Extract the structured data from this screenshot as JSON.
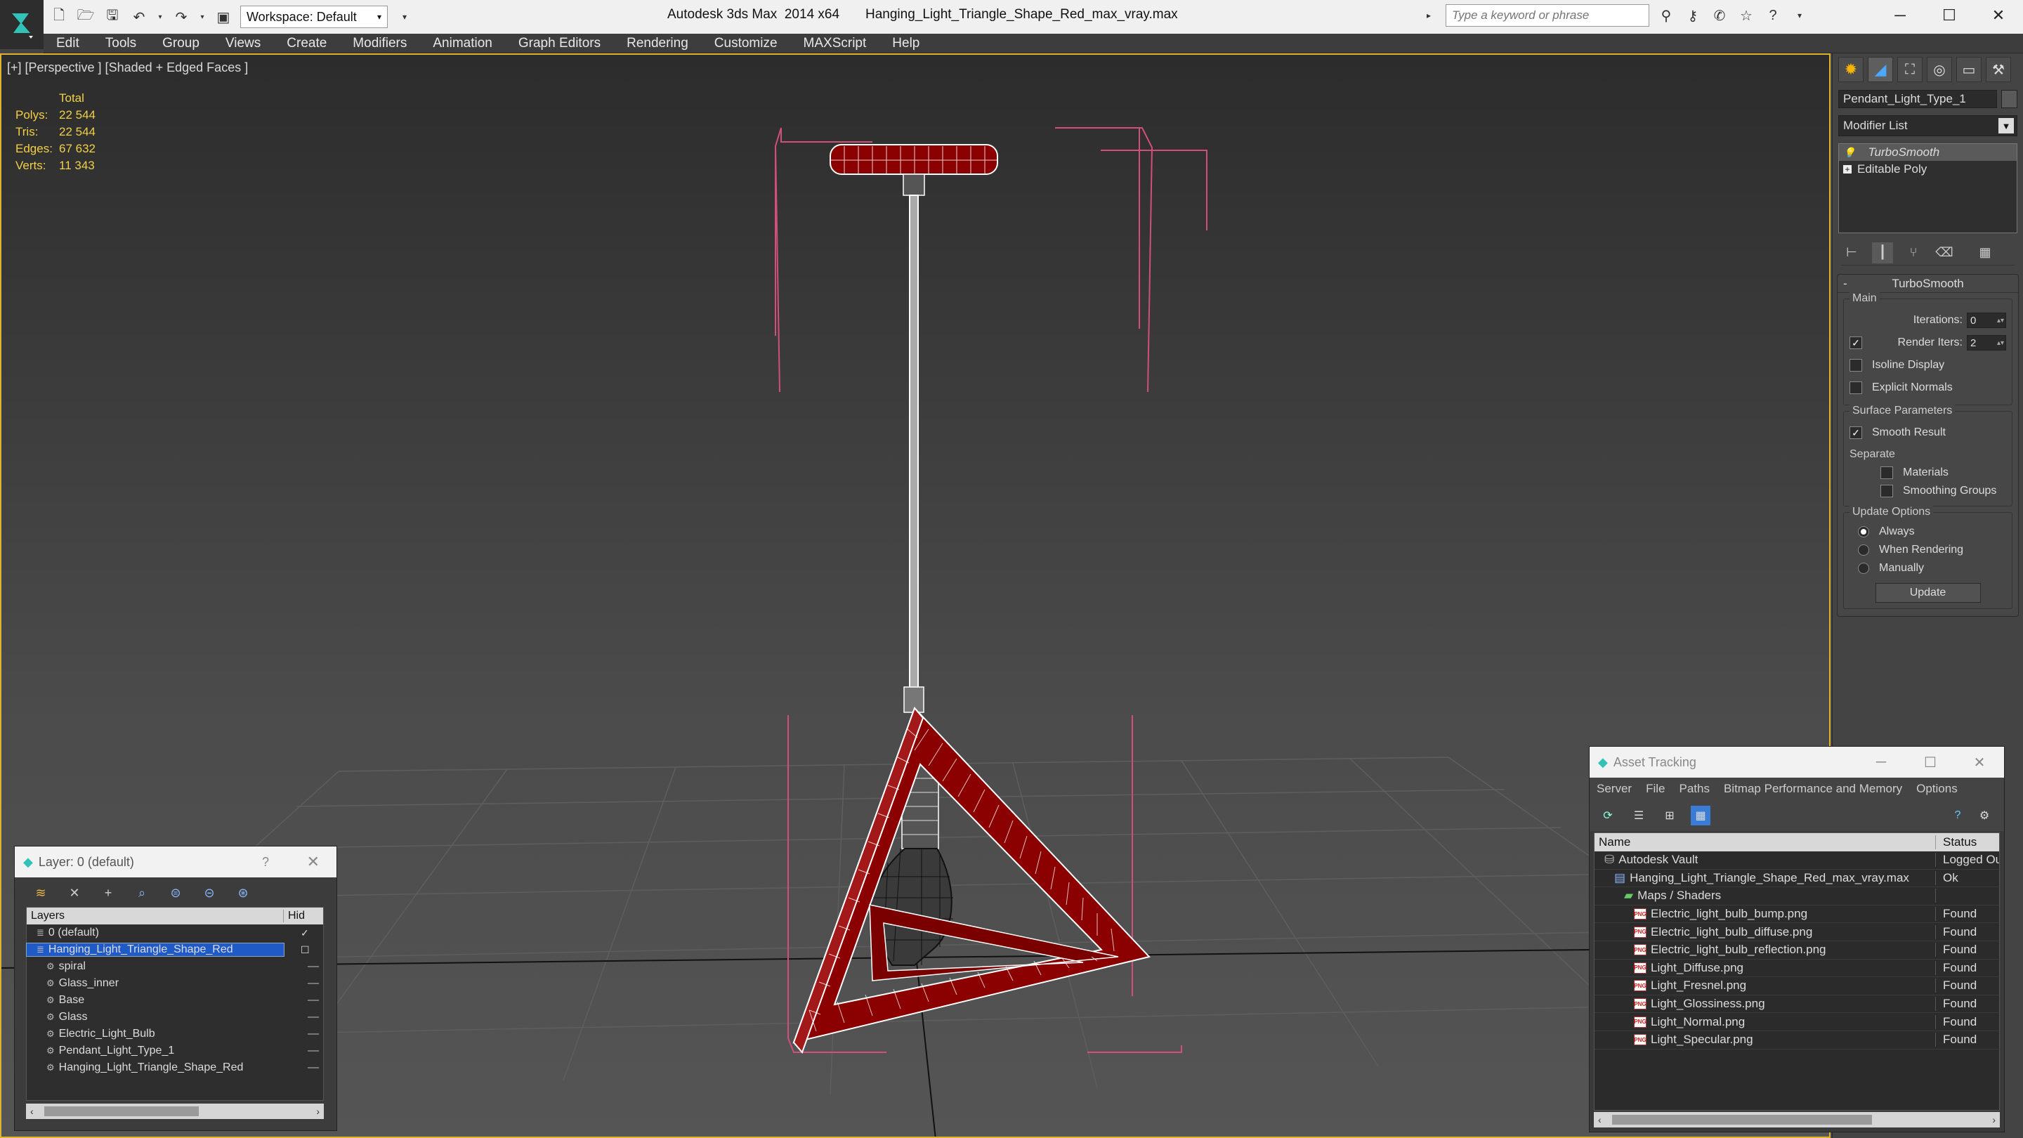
{
  "titlebar": {
    "workspace_label": "Workspace: Default",
    "app_title": "Autodesk 3ds Max  2014 x64",
    "file_title": "Hanging_Light_Triangle_Shape_Red_max_vray.max",
    "search_placeholder": "Type a keyword or phrase"
  },
  "menu": [
    "Edit",
    "Tools",
    "Group",
    "Views",
    "Create",
    "Modifiers",
    "Animation",
    "Graph Editors",
    "Rendering",
    "Customize",
    "MAXScript",
    "Help"
  ],
  "viewport": {
    "label": "[+] [Perspective ] [Shaded + Edged Faces ]",
    "stats_header": "Total",
    "stats": [
      {
        "k": "Polys:",
        "v": "22 544"
      },
      {
        "k": "Tris:",
        "v": "22 544"
      },
      {
        "k": "Edges:",
        "v": "67 632"
      },
      {
        "k": "Verts:",
        "v": "11 343"
      }
    ],
    "model_color": "#8b0000",
    "bracket_color": "#d0507a"
  },
  "command_panel": {
    "object_name": "Pendant_Light_Type_1",
    "modifier_list": "Modifier List",
    "stack": [
      "TurboSmooth",
      "Editable Poly"
    ],
    "rollout_title": "TurboSmooth",
    "main_group": "Main",
    "iterations_label": "Iterations:",
    "iterations_value": "0",
    "render_iters_label": "Render Iters:",
    "render_iters_value": "2",
    "isoline_label": "Isoline Display",
    "explicit_label": "Explicit Normals",
    "surface_group": "Surface Parameters",
    "smooth_label": "Smooth Result",
    "separate_label": "Separate",
    "materials_label": "Materials",
    "smoothing_label": "Smoothing Groups",
    "update_group": "Update Options",
    "always_label": "Always",
    "when_render_label": "When Rendering",
    "manually_label": "Manually",
    "update_button": "Update"
  },
  "asset_tracking": {
    "title": "Asset Tracking",
    "menu": [
      "Server",
      "File",
      "Paths",
      "Bitmap Performance and Memory",
      "Options"
    ],
    "col_name": "Name",
    "col_status": "Status",
    "rows": [
      {
        "name": "Autodesk Vault",
        "status": "Logged Ou",
        "indent": 1,
        "icon": "vault"
      },
      {
        "name": "Hanging_Light_Triangle_Shape_Red_max_vray.max",
        "status": "Ok",
        "indent": 2,
        "icon": "max"
      },
      {
        "name": "Maps / Shaders",
        "status": "",
        "indent": 3,
        "icon": "folder"
      },
      {
        "name": "Electric_light_bulb_bump.png",
        "status": "Found",
        "indent": 4,
        "icon": "png"
      },
      {
        "name": "Electric_light_bulb_diffuse.png",
        "status": "Found",
        "indent": 4,
        "icon": "png"
      },
      {
        "name": "Electric_light_bulb_reflection.png",
        "status": "Found",
        "indent": 4,
        "icon": "png"
      },
      {
        "name": "Light_Diffuse.png",
        "status": "Found",
        "indent": 4,
        "icon": "png"
      },
      {
        "name": "Light_Fresnel.png",
        "status": "Found",
        "indent": 4,
        "icon": "png"
      },
      {
        "name": "Light_Glossiness.png",
        "status": "Found",
        "indent": 4,
        "icon": "png"
      },
      {
        "name": "Light_Normal.png",
        "status": "Found",
        "indent": 4,
        "icon": "png"
      },
      {
        "name": "Light_Specular.png",
        "status": "Found",
        "indent": 4,
        "icon": "png"
      }
    ]
  },
  "layer_window": {
    "title": "Layer: 0 (default)",
    "help": "?",
    "col_layers": "Layers",
    "col_hide": "Hid",
    "rows": [
      {
        "name": "0 (default)",
        "indent": 1,
        "icon": "layer"
      },
      {
        "name": "Hanging_Light_Triangle_Shape_Red",
        "indent": 1,
        "icon": "layer",
        "selected": true
      },
      {
        "name": "spiral",
        "indent": 2,
        "icon": "obj"
      },
      {
        "name": "Glass_inner",
        "indent": 2,
        "icon": "obj"
      },
      {
        "name": "Base",
        "indent": 2,
        "icon": "obj"
      },
      {
        "name": "Glass",
        "indent": 2,
        "icon": "obj"
      },
      {
        "name": "Electric_Light_Bulb",
        "indent": 2,
        "icon": "obj"
      },
      {
        "name": "Pendant_Light_Type_1",
        "indent": 2,
        "icon": "obj"
      },
      {
        "name": "Hanging_Light_Triangle_Shape_Red",
        "indent": 2,
        "icon": "obj"
      }
    ]
  }
}
